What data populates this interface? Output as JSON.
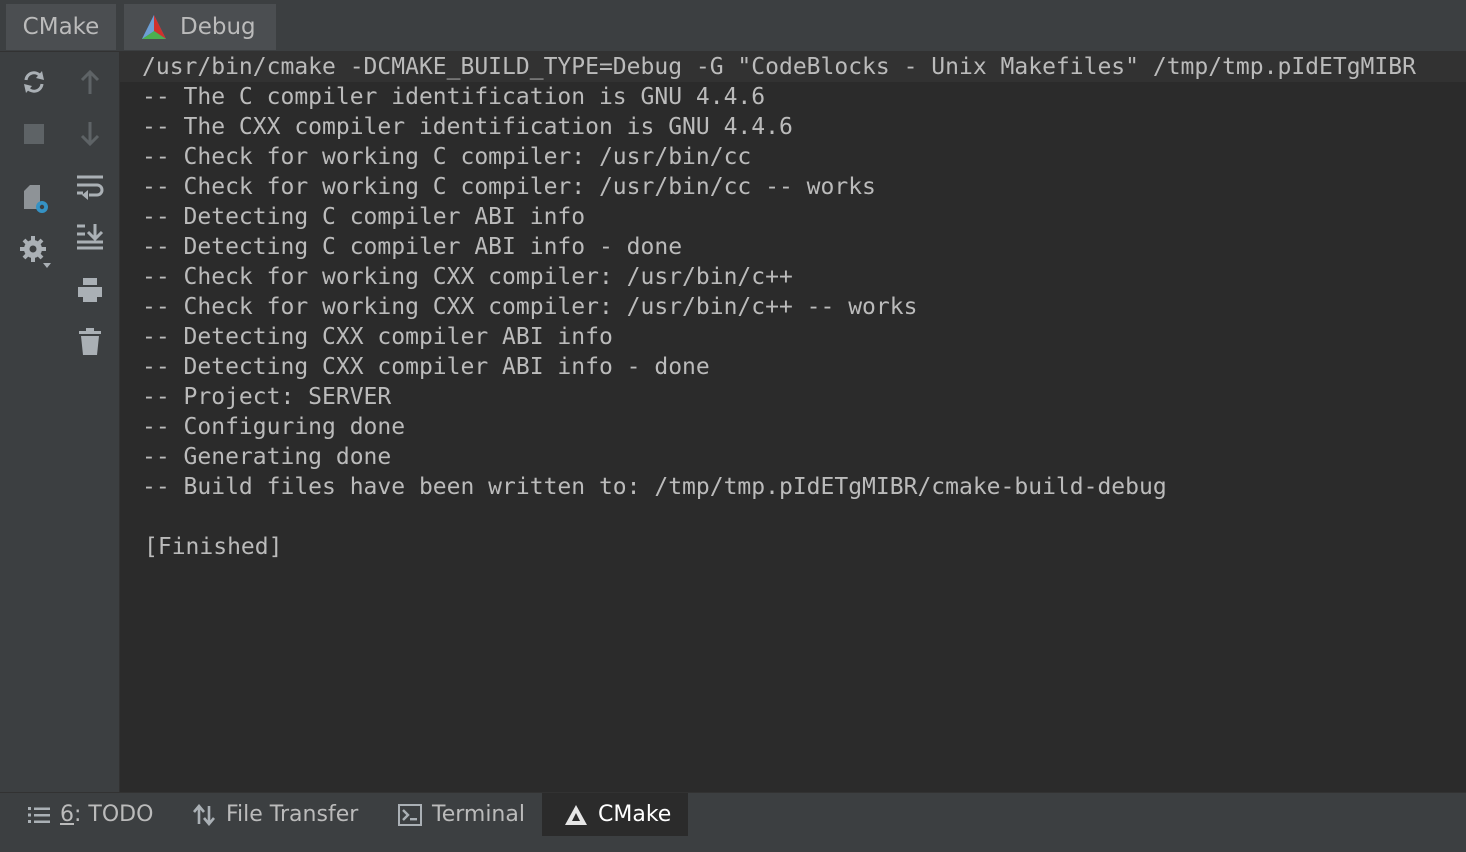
{
  "panel": {
    "title": "CMake"
  },
  "tabs": [
    {
      "label": "Debug",
      "icon": "cmake-triangle-icon"
    }
  ],
  "toolbar": {
    "left_column": [
      "refresh-icon",
      "stop-icon",
      "cmake-settings-icon",
      "gear-icon"
    ],
    "right_column": [
      "arrow-up-icon",
      "arrow-down-icon",
      "soft-wrap-icon",
      "scroll-to-end-icon",
      "print-icon",
      "trash-icon"
    ]
  },
  "console": {
    "lines": [
      "/usr/bin/cmake -DCMAKE_BUILD_TYPE=Debug -G \"CodeBlocks - Unix Makefiles\" /tmp/tmp.pIdETgMIBR",
      "-- The C compiler identification is GNU 4.4.6",
      "-- The CXX compiler identification is GNU 4.4.6",
      "-- Check for working C compiler: /usr/bin/cc",
      "-- Check for working C compiler: /usr/bin/cc -- works",
      "-- Detecting C compiler ABI info",
      "-- Detecting C compiler ABI info - done",
      "-- Check for working CXX compiler: /usr/bin/c++",
      "-- Check for working CXX compiler: /usr/bin/c++ -- works",
      "-- Detecting CXX compiler ABI info",
      "-- Detecting CXX compiler ABI info - done",
      "-- Project: SERVER",
      "-- Configuring done",
      "-- Generating done",
      "-- Build files have been written to: /tmp/tmp.pIdETgMIBR/cmake-build-debug"
    ],
    "finished": "[Finished]"
  },
  "bottom_tabs": [
    {
      "mnemonic": "6",
      "label": ": TODO",
      "icon": "list-icon"
    },
    {
      "label": "File Transfer",
      "icon": "transfer-arrows-icon"
    },
    {
      "label": "Terminal",
      "icon": "terminal-icon"
    },
    {
      "label": "CMake",
      "icon": "cmake-triangle-icon",
      "active": true
    }
  ]
}
